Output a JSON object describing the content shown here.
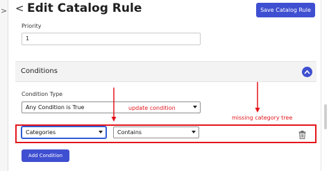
{
  "header": {
    "back_glyph": "<",
    "title": "Edit Catalog Rule",
    "save_label": "Save Catalog Rule"
  },
  "sidebar": {
    "expand_glyph": ">"
  },
  "priority": {
    "label": "Priority",
    "value": "1"
  },
  "conditions": {
    "title": "Conditions",
    "type_label": "Condition Type",
    "type_value": "Any Condition is True",
    "row": {
      "attribute_value": "Categories",
      "operator_value": "Contains"
    },
    "add_label": "Add Condition"
  },
  "annotations": {
    "update_condition": "update condition",
    "missing_category_tree": "missing category tree"
  },
  "colors": {
    "accent": "#3f4fd1",
    "annotation_red": "#e3141b"
  },
  "icons": [
    "chevron-right-icon",
    "back-arrow-icon",
    "chevron-up-icon",
    "trash-icon"
  ]
}
